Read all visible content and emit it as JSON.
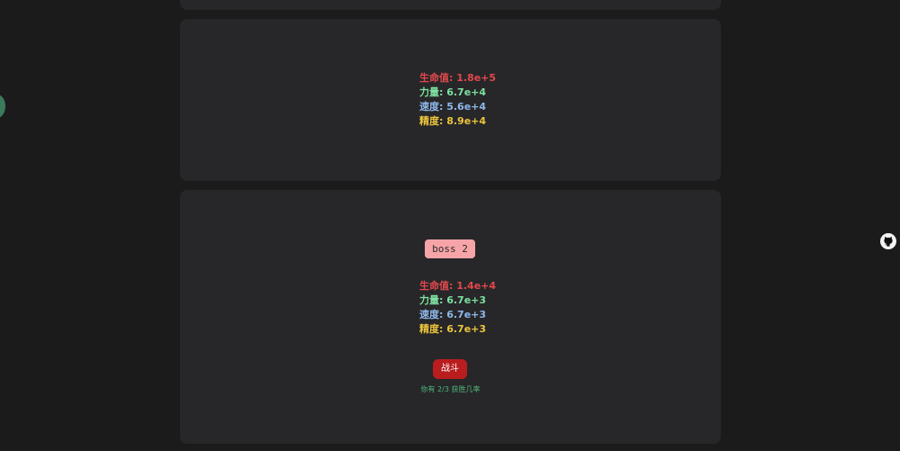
{
  "stats_card": {
    "hp_label": "生命值: 1.8e+5",
    "str_label": "力量: 6.7e+4",
    "spd_label": "速度: 5.6e+4",
    "acc_label": "精度: 8.9e+4"
  },
  "boss_card": {
    "name": "boss 2",
    "hp_label": "生命值: 1.4e+4",
    "str_label": "力量: 6.7e+3",
    "spd_label": "速度: 6.7e+3",
    "acc_label": "精度: 6.7e+3",
    "fight_label": "战斗",
    "win_chance": "你有 2/3 获胜几率"
  },
  "icons": {
    "right_edge": "github-icon",
    "left_edge": "side-toggle-icon"
  },
  "colors": {
    "hp": "#e2484c",
    "strength": "#7ee0a1",
    "speed": "#8fb8ec",
    "accuracy": "#ecc53d",
    "fight_button": "#b91d1d",
    "boss_tag": "#f7a4a8"
  }
}
